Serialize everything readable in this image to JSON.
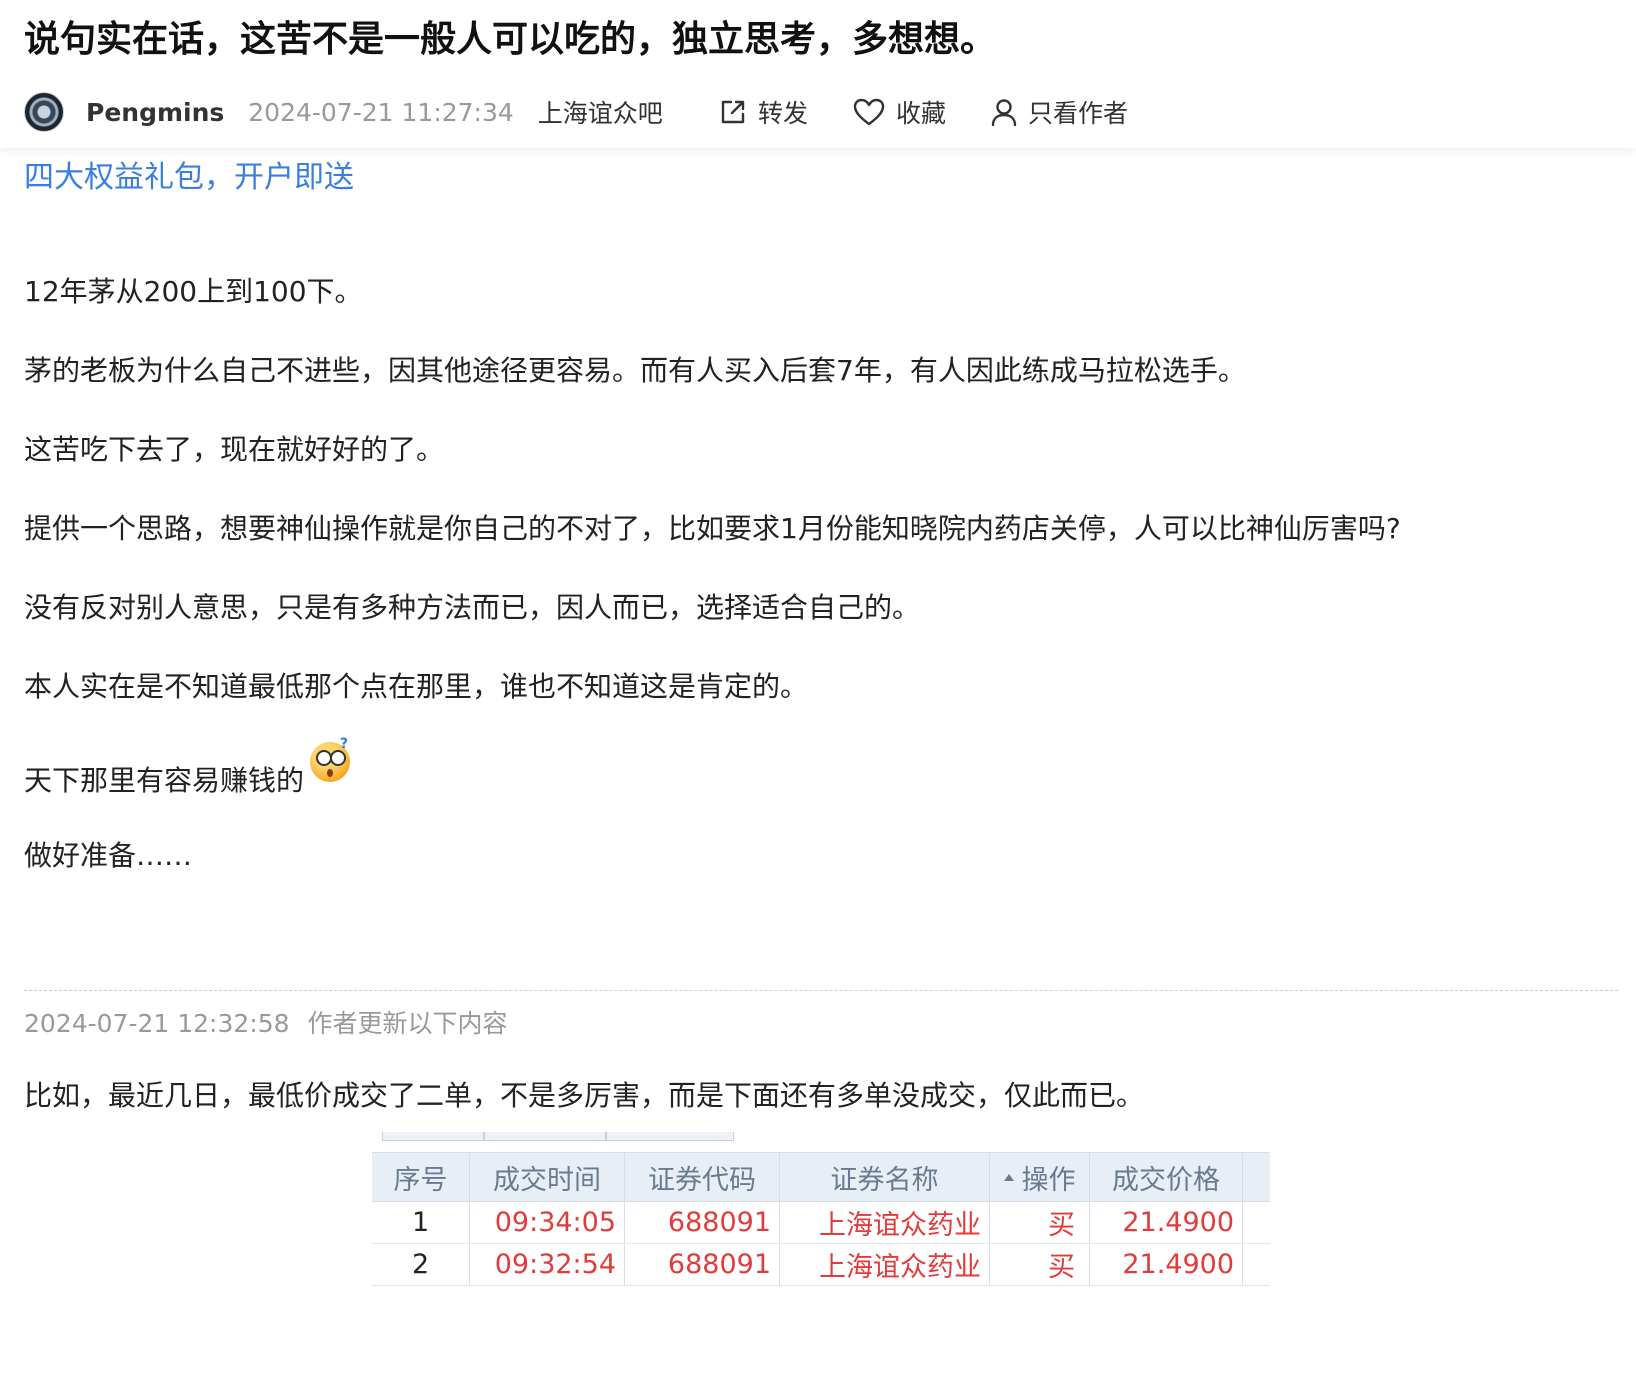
{
  "post": {
    "title": "说句实在话，这苦不是一般人可以吃的，独立思考，多想想。",
    "author": "Pengmins",
    "timestamp": "2024-07-21 11:27:34",
    "bar": "上海谊众吧",
    "actions": {
      "share": "转发",
      "favorite": "收藏",
      "author_only": "只看作者"
    },
    "promo": "四大权益礼包，开户即送",
    "paragraphs": [
      "12年茅从200上到100下。",
      "茅的老板为什么自己不进些，因其他途径更容易。而有人买入后套7年，有人因此练成马拉松选手。",
      "这苦吃下去了，现在就好好的了。",
      "提供一个思路，想要神仙操作就是你自己的不对了，比如要求1月份能知晓院内药店关停，人可以比神仙厉害吗?",
      "没有反对别人意思，只是有多种方法而已，因人而已，选择适合自己的。",
      "本人实在是不知道最低那个点在那里，谁也不知道这是肯定的。",
      "天下那里有容易赚钱的",
      "做好准备……"
    ]
  },
  "update": {
    "timestamp": "2024-07-21 12:32:58",
    "label": "作者更新以下内容",
    "text": "比如，最近几日，最低价成交了二单，不是多厉害，而是下面还有多单没成交，仅此而已。"
  },
  "trade_table": {
    "headers": [
      "序号",
      "成交时间",
      "证券代码",
      "证券名称",
      "操作",
      "成交价格"
    ],
    "rows": [
      [
        "1",
        "09:34:05",
        "688091",
        "上海谊众药业",
        "买",
        "21.4900"
      ],
      [
        "2",
        "09:32:54",
        "688091",
        "上海谊众药业",
        "买",
        "21.4900"
      ]
    ]
  },
  "colors": {
    "link": "#3a7ee0",
    "trade_red": "#e23b3b",
    "table_header_bg": "#e8eef6"
  },
  "icons": {
    "share": "share-icon",
    "favorite": "heart-icon",
    "author_only": "user-icon",
    "emoji": "dizzy-confused-emoji"
  }
}
